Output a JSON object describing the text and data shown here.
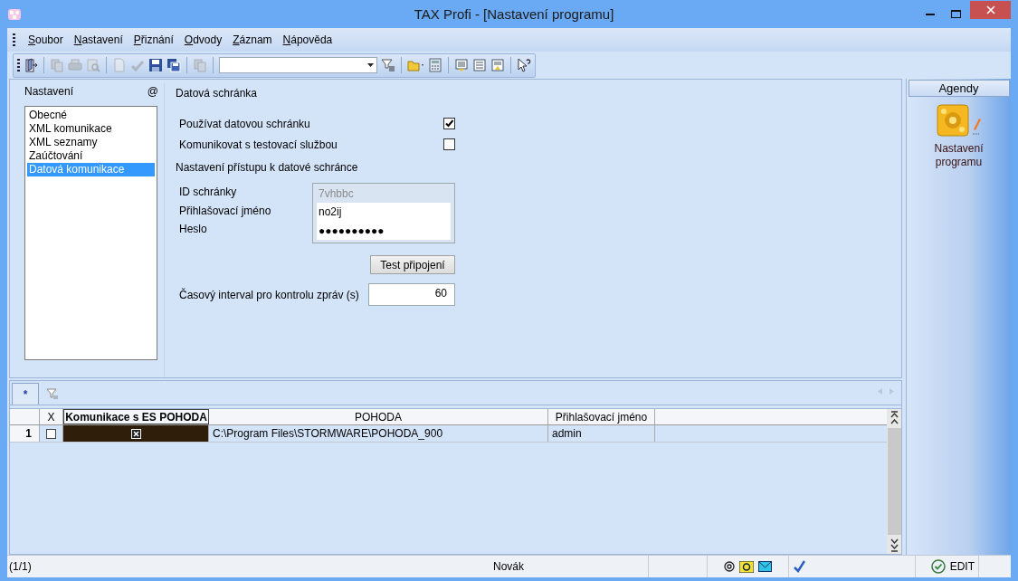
{
  "window": {
    "title": "TAX Profi - [Nastavení programu]"
  },
  "menu": [
    {
      "label": "Soubor"
    },
    {
      "label": "Nastavení"
    },
    {
      "label": "Přiznání"
    },
    {
      "label": "Odvody"
    },
    {
      "label": "Záznam"
    },
    {
      "label": "Nápověda"
    }
  ],
  "toolbar": [
    {
      "kind": "exit",
      "disabled": false
    },
    {
      "kind": "sep"
    },
    {
      "kind": "copy",
      "disabled": true
    },
    {
      "kind": "print",
      "disabled": true
    },
    {
      "kind": "preview",
      "disabled": true
    },
    {
      "kind": "sep"
    },
    {
      "kind": "new",
      "disabled": true
    },
    {
      "kind": "check",
      "disabled": true
    },
    {
      "kind": "save",
      "disabled": false
    },
    {
      "kind": "saveall",
      "disabled": false
    },
    {
      "kind": "sep"
    },
    {
      "kind": "copy",
      "disabled": true
    },
    {
      "kind": "sep"
    },
    {
      "kind": "combo"
    },
    {
      "kind": "filter",
      "disabled": false
    },
    {
      "kind": "sep"
    },
    {
      "kind": "folder",
      "disabled": false
    },
    {
      "kind": "calc",
      "disabled": false
    },
    {
      "kind": "sep"
    },
    {
      "kind": "listdown",
      "disabled": false
    },
    {
      "kind": "list",
      "disabled": false
    },
    {
      "kind": "listup",
      "disabled": false
    },
    {
      "kind": "sep"
    },
    {
      "kind": "help",
      "disabled": false
    }
  ],
  "settings": {
    "nav_title": "Nastavení",
    "nav_at": "@",
    "nav_items": [
      {
        "label": "Obecné",
        "selected": false
      },
      {
        "label": "XML komunikace",
        "selected": false
      },
      {
        "label": "XML seznamy",
        "selected": false
      },
      {
        "label": "Zaúčtování",
        "selected": false
      },
      {
        "label": "Datová komunikace",
        "selected": true
      }
    ],
    "section_title": "Datová schránka",
    "checkboxes": [
      {
        "label": "Používat datovou schránku",
        "checked": true
      },
      {
        "label": "Komunikovat s testovací službou",
        "checked": false
      }
    ],
    "access_title": "Nastavení přístupu k datové schránce",
    "fields": [
      {
        "label": "ID schránky",
        "value": "7vhbbc",
        "disabled": true
      },
      {
        "label": "Přihlašovací jméno",
        "value": "no2ij",
        "disabled": false
      },
      {
        "label": "Heslo",
        "value": "●●●●●●●●●●",
        "disabled": false
      }
    ],
    "test_button": "Test připojení",
    "interval": {
      "label": "Časový interval pro kontrolu zpráv (s)",
      "value": "60"
    }
  },
  "grid": {
    "tabs": [
      {
        "kind": "new",
        "label": "*",
        "selected": true
      },
      {
        "kind": "filter",
        "selected": false
      }
    ],
    "columns": [
      "X",
      "Komunikace s ES POHODA",
      "POHODA",
      "Přihlašovací jméno"
    ],
    "rows": [
      {
        "number": "1",
        "x_checked": false,
        "es_checked": true,
        "pohoda": "C:\\Program Files\\STORMWARE\\POHODA_900",
        "login": "admin"
      }
    ]
  },
  "agenda": {
    "title": "Agendy",
    "items": [
      {
        "label": "Nastavení programu"
      }
    ]
  },
  "status_bar": {
    "position": "(1/1)",
    "user": "Novák",
    "mode": "EDIT"
  }
}
